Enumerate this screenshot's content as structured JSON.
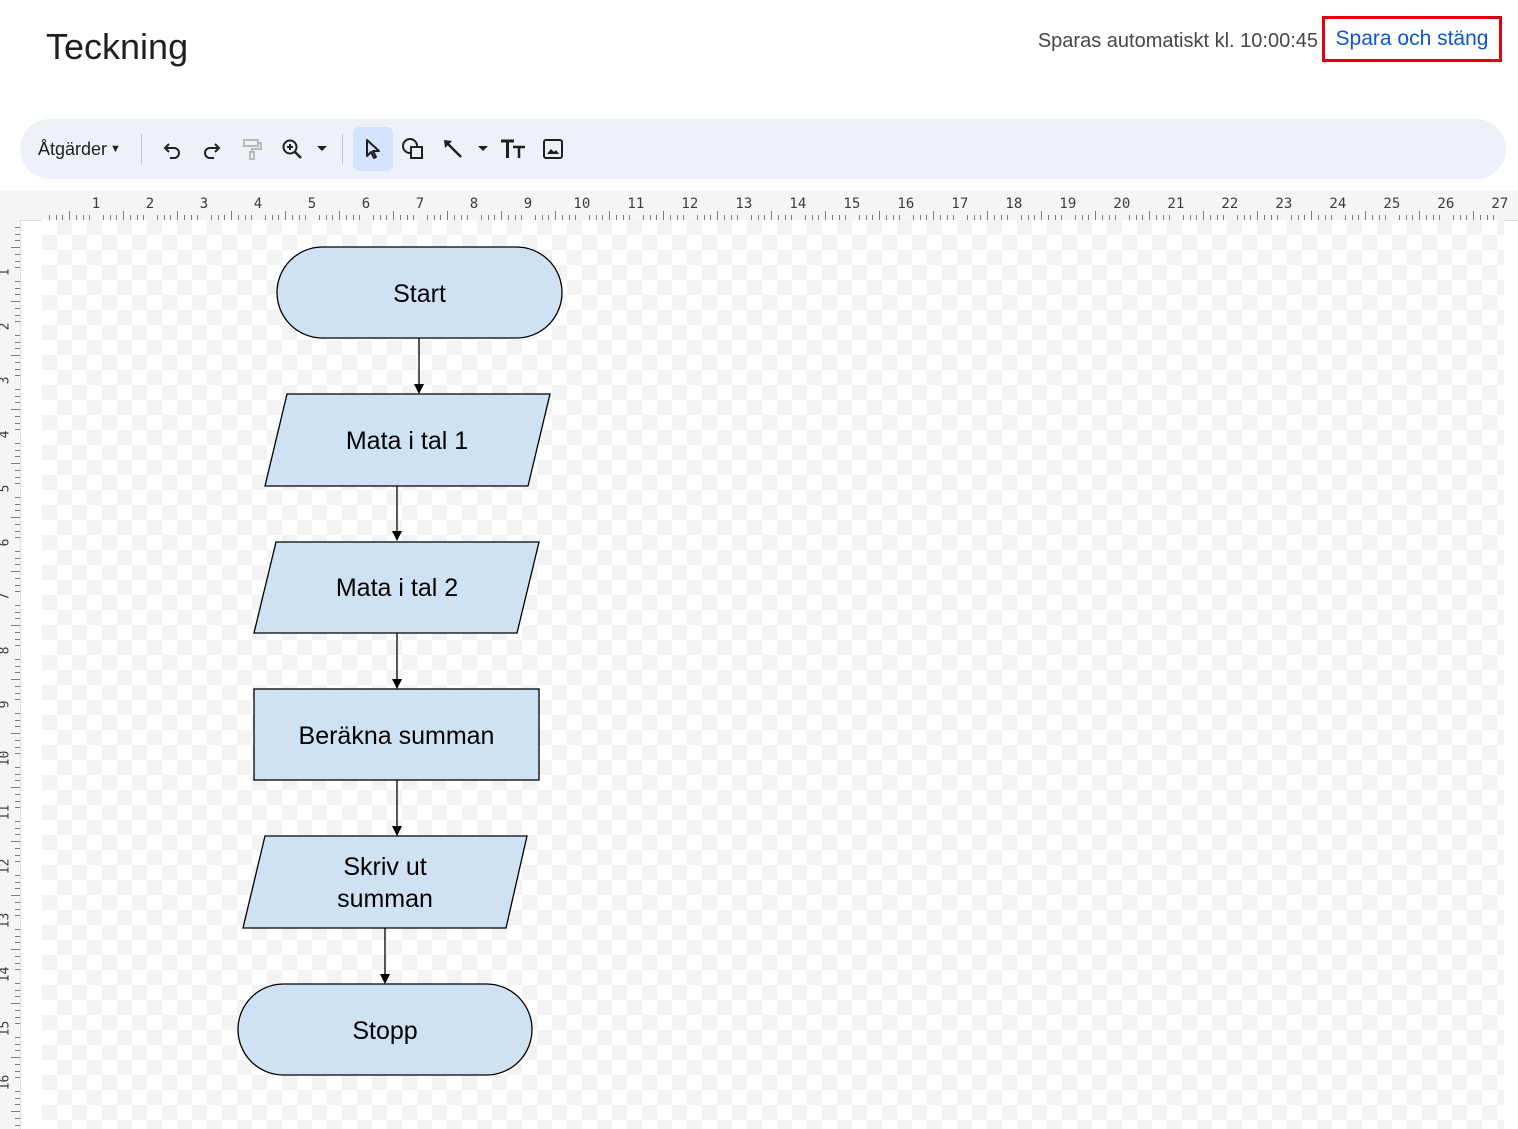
{
  "header": {
    "title": "Teckning",
    "autosave": "Sparas automatiskt kl. 10:00:45",
    "save_close": "Spara och stäng"
  },
  "toolbar": {
    "actions_label": "Åtgärder",
    "icons": [
      "undo-icon",
      "redo-icon",
      "paint-format-icon",
      "zoom-icon",
      "select-icon",
      "shape-icon",
      "line-icon",
      "text-box-icon",
      "image-icon"
    ]
  },
  "ruler": {
    "top": [
      "1",
      "2",
      "3",
      "4",
      "5",
      "6",
      "7",
      "8",
      "9",
      "10",
      "11",
      "12",
      "13",
      "14",
      "15",
      "16",
      "17",
      "18",
      "19",
      "20",
      "21",
      "22",
      "23",
      "24",
      "25",
      "26",
      "27"
    ],
    "left": [
      "1",
      "2",
      "3",
      "4",
      "5",
      "6",
      "7",
      "8",
      "9",
      "10",
      "11",
      "12",
      "13",
      "14",
      "15",
      "16"
    ]
  },
  "flowchart": {
    "start": "Start",
    "input1": "Mata i tal 1",
    "input2": "Mata i tal 2",
    "process": "Beräkna summan",
    "output_line1": "Skriv ut",
    "output_line2": "summan",
    "stop": "Stopp",
    "fill_color": "#cfe2f3",
    "stroke_color": "#000000"
  }
}
